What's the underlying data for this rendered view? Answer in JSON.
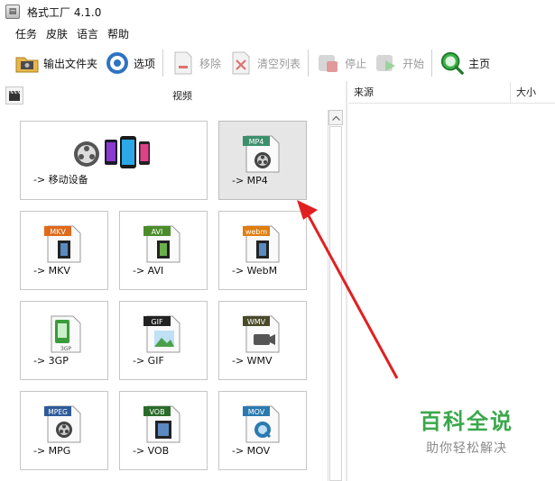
{
  "window": {
    "title": "格式工厂 4.1.0"
  },
  "menu": {
    "items": [
      "任务",
      "皮肤",
      "语言",
      "帮助"
    ]
  },
  "toolbar": {
    "output_folder": "输出文件夹",
    "options": "选项",
    "remove": "移除",
    "clear_list": "清空列表",
    "stop": "停止",
    "start": "开始",
    "home": "主页"
  },
  "left_panel": {
    "title": "视频"
  },
  "tiles": [
    {
      "label": "-> 移动设备",
      "icon": "mobile-devices-icon"
    },
    {
      "label": "-> MP4",
      "icon": "mp4-file-icon",
      "badge": "MP4",
      "badge_color": "#3c8f6b"
    },
    {
      "label": "-> MKV",
      "icon": "mkv-file-icon",
      "badge": "MKV",
      "badge_color": "#e06a1a"
    },
    {
      "label": "-> AVI",
      "icon": "avi-file-icon",
      "badge": "AVI",
      "badge_color": "#4a8c2a"
    },
    {
      "label": "-> WebM",
      "icon": "webm-file-icon",
      "badge": "webm",
      "badge_color": "#e07d10"
    },
    {
      "label": "-> 3GP",
      "icon": "3gp-file-icon",
      "badge": "3GP",
      "badge_color": "#3a9b3a"
    },
    {
      "label": "-> GIF",
      "icon": "gif-file-icon",
      "badge": "GIF",
      "badge_color": "#222222"
    },
    {
      "label": "-> WMV",
      "icon": "wmv-file-icon",
      "badge": "WMV",
      "badge_color": "#4a4a2a"
    },
    {
      "label": "-> MPG",
      "icon": "mpg-file-icon",
      "badge": "MPEG",
      "badge_color": "#2e5a9a"
    },
    {
      "label": "-> VOB",
      "icon": "vob-file-icon",
      "badge": "VOB",
      "badge_color": "#2a6b2a"
    },
    {
      "label": "-> MOV",
      "icon": "mov-file-icon",
      "badge": "MOV",
      "badge_color": "#2a7ab0"
    }
  ],
  "file_table": {
    "columns": [
      "来源",
      "大小"
    ]
  },
  "watermark": {
    "line1": "百科全说",
    "line2": "助你轻松解决"
  },
  "colors": {
    "arrow": "#e02020",
    "watermark_green": "#3aa84a",
    "selected_tile": "#e6e6e6"
  }
}
